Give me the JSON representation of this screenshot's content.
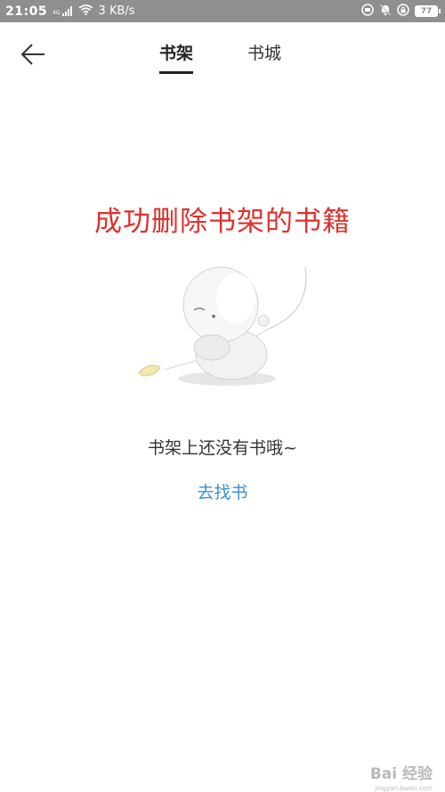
{
  "status_bar": {
    "time": "21:05",
    "network_type": "4G",
    "speed": "3 KB/s",
    "battery": "77",
    "icons": [
      "signal-icon",
      "wifi-icon",
      "sync-icon",
      "mute-bell-icon",
      "lock-rotation-icon",
      "battery-icon"
    ]
  },
  "header": {
    "tabs": [
      {
        "label": "书架",
        "active": true
      },
      {
        "label": "书城",
        "active": false
      }
    ]
  },
  "headline": "成功删除书架的书籍",
  "empty_state": {
    "message": "书架上还没有书哦~",
    "action_label": "去找书"
  },
  "watermark": {
    "text": "Bai  经验",
    "subtext": "jingyan.baidu.com"
  },
  "colors": {
    "status_bar_bg": "#8f8f8f",
    "headline": "#e0302c",
    "link": "#3a8fd0"
  }
}
